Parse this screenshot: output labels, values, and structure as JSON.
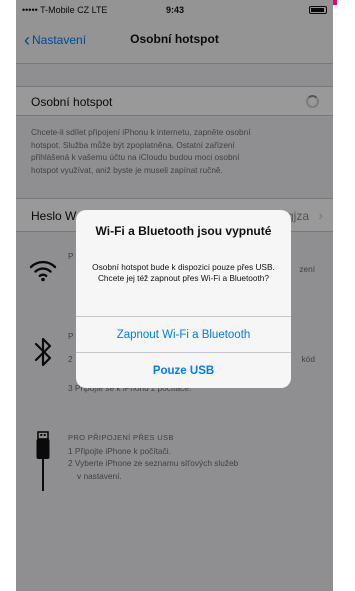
{
  "statusbar": {
    "carrier": "••••• T-Mobile CZ  LTE",
    "time": "9:43"
  },
  "navbar": {
    "back_label": "Nastavení",
    "title": "Osobní hotspot"
  },
  "hotspot_cell": {
    "label": "Osobní hotspot"
  },
  "hotspot_footer": [
    "Chcete-li sdílet připojení iPhonu k internetu, zapněte osobní",
    "hotspot. Služba může být zpoplatněna. Ostatní zařízení",
    "přihlášená k vašemu účtu na iCloudu budou moci osobní",
    "hotspot využívat, aniž byste je museli zapínat ručně."
  ],
  "password_cell": {
    "label": "Heslo W",
    "value": "gjza"
  },
  "instructions": {
    "wifi": {
      "line1": "P",
      "line2": "zení",
      "line3": ""
    },
    "bluetooth": {
      "line1": "P",
      "line2": "2",
      "line2_tail": "kód",
      "line3": "n",
      "line4": "3 Připojte se k iPhonu z počítače."
    },
    "usb": {
      "heading": "PRO PŘIPOJENÍ PŘES USB",
      "line1": "1 Připojte iPhone k počítači.",
      "line2": "2 Vyberte iPhone ze seznamu síťových služeb",
      "line3": "v nastavení."
    }
  },
  "alert": {
    "title": "Wi-Fi a Bluetooth jsou vypnuté",
    "message": "Osobní hotspot bude k dispozici pouze přes USB. Chcete jej též zapnout přes Wi-Fi a Bluetooth?",
    "primary_button": "Zapnout Wi-Fi a Bluetooth",
    "secondary_button": "Pouze USB"
  },
  "colors": {
    "accent": "#e6007e",
    "ios_blue": "#007aff"
  },
  "icons": {
    "wifi": "wifi-icon",
    "bluetooth": "bluetooth-icon",
    "usb": "usb-cable-icon",
    "spinner": "loading-spinner-icon",
    "back": "chevron-left-icon",
    "disclosure": "chevron-right-icon"
  }
}
